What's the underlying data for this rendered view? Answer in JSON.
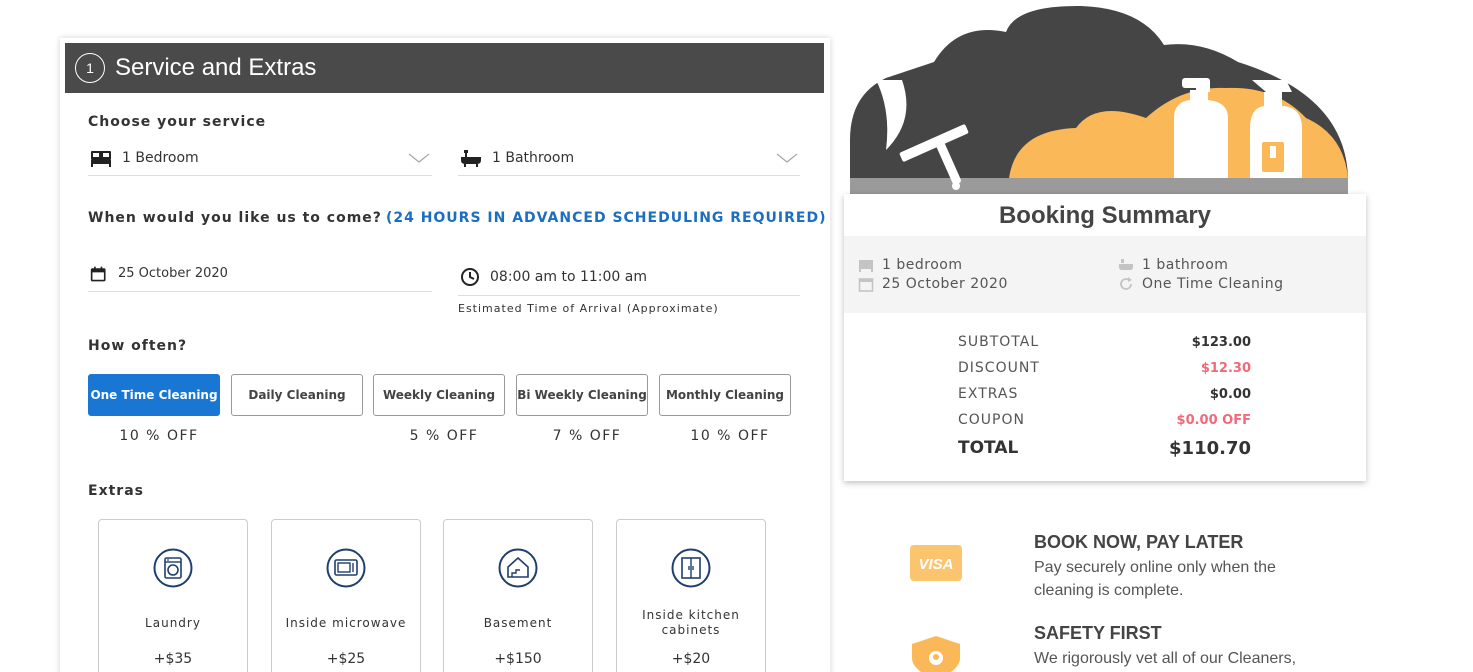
{
  "service_section": {
    "step": "1",
    "title": "Service and Extras",
    "choose_label": "Choose your service",
    "bedroom_value": "1 Bedroom",
    "bathroom_value": "1 Bathroom",
    "when_label": "When would you like us to come?",
    "advance_note": "(24 HOURS IN ADVANCED SCHEDULING REQUIRED)",
    "date_value": "25 October 2020",
    "time_value": "08:00 am to 11:00 am",
    "eta_note": "Estimated Time of Arrival (Approximate)",
    "how_often_label": "How often?",
    "frequencies": [
      {
        "label": "One Time Cleaning",
        "discount": "10 % OFF",
        "active": true
      },
      {
        "label": "Daily Cleaning",
        "discount": "",
        "active": false
      },
      {
        "label": "Weekly Cleaning",
        "discount": "5 % OFF",
        "active": false
      },
      {
        "label": "Bi Weekly Cleaning",
        "discount": "7 % OFF",
        "active": false
      },
      {
        "label": "Monthly Cleaning",
        "discount": "10 % OFF",
        "active": false
      }
    ],
    "extras_label": "Extras",
    "extras": [
      {
        "name": "Laundry",
        "price": "+$35",
        "icon": "washing-machine-icon"
      },
      {
        "name": "Inside microwave",
        "price": "+$25",
        "icon": "microwave-icon"
      },
      {
        "name": "Basement",
        "price": "+$150",
        "icon": "basement-icon"
      },
      {
        "name": "Inside kitchen cabinets",
        "price": "+$20",
        "icon": "cabinet-icon"
      }
    ]
  },
  "summary": {
    "title": "Booking Summary",
    "bedroom": "1 bedroom",
    "bathroom": "1 bathroom",
    "date": "25 October 2020",
    "frequency": "One Time Cleaning",
    "subtotal_label": "SUBTOTAL",
    "subtotal": "$123.00",
    "discount_label": "DISCOUNT",
    "discount": "$12.30",
    "extras_label": "EXTRAS",
    "extras": "$0.00",
    "coupon_label": "COUPON",
    "coupon": "$0.00 OFF",
    "total_label": "TOTAL",
    "total": "$110.70"
  },
  "promos": [
    {
      "title": "BOOK NOW, PAY LATER",
      "text": "Pay securely online only when the cleaning is complete.",
      "badge": "VISA"
    },
    {
      "title": "SAFETY FIRST",
      "text": "We rigorously vet all of our Cleaners,"
    }
  ],
  "colors": {
    "header_bg": "#4a4a4a",
    "accent_blue": "#1976d2",
    "link_blue": "#1b6ec2",
    "discount_red": "#f06a7a",
    "hero_orange": "#fbb859",
    "hero_dark": "#454545",
    "icon_navy": "#1f3f6e"
  }
}
